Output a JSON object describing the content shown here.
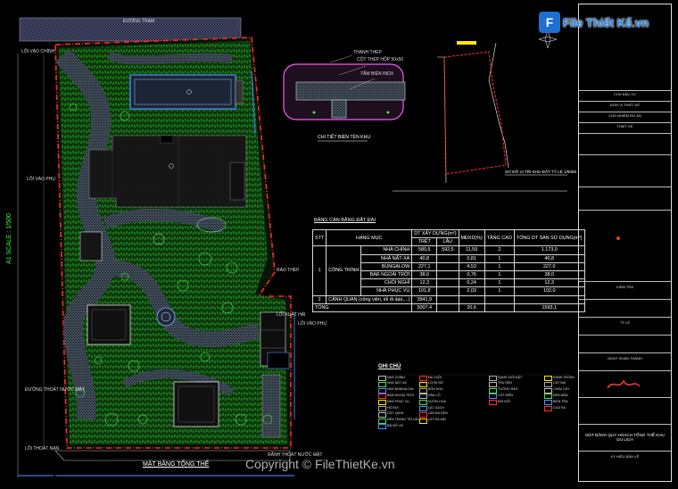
{
  "plan": {
    "top_road": "ĐƯỜNG TRẠM",
    "scale_label": "A1 SCALE : 1/500",
    "plan_title": "MẶT BẰNG TỔNG THỂ",
    "gate_labels": [
      "LỐI VÀO CHÍNH",
      "LỐI VÀO PHỤ",
      "LỐI THOÁT NẠN",
      "LỐI VÀO PHỤ"
    ],
    "side_labels": [
      "RÀO THÉP",
      "LỐI XUẤT HẢI",
      "ĐƯỜNG THOÁT NƯỚC MẶT",
      "RÃNH THOÁT NƯỚC MẶT"
    ],
    "colors": {
      "boundary": "#ff2a2a",
      "vegetation": "#2db52d",
      "water": "#aeb6c8",
      "building": "#1a1a1a",
      "road": "#3a3a3a"
    }
  },
  "details": {
    "section_title": "CHI TIẾT BIỂN TÊN KHU",
    "section_callouts": [
      "THANH THÉP",
      "CỘT THÉP HỘP 50x50",
      "TẤM BIỂN INOX"
    ],
    "location_title": "SƠ ĐỒ VỊ TRÍ KHU ĐẤT TỶ LỆ 1/5000"
  },
  "table": {
    "title": "BẢNG CÂN BẰNG ĐẤT ĐAI",
    "headers": [
      "STT",
      "HẠNG MỤC",
      "DT XÂY DỰNG(m²)",
      "MĐXD(%)",
      "TẦNG CAO",
      "TỔNG DT SÀN SỬ DỤNG(m²)"
    ],
    "subheaders": [
      "TRỆT",
      "LẦU"
    ],
    "group_label": "CÔNG TRÌNH",
    "rows": [
      {
        "stt": "1",
        "name": "NHÀ CHÍNH",
        "tret": "580,5",
        "lau": "592,5",
        "md": "11,59",
        "tang": "2",
        "san": "1.173,0"
      },
      {
        "stt": "",
        "name": "NHÀ NẤT-XA",
        "tret": "40,8",
        "lau": "",
        "md": "0,81",
        "tang": "1",
        "san": "40,8"
      },
      {
        "stt": "",
        "name": "BUNGALOW",
        "tret": "227,1",
        "lau": "",
        "md": "4,53",
        "tang": "1",
        "san": "227,0"
      },
      {
        "stt": "",
        "name": "BAR NGOÀI TRỜI",
        "tret": "38,0",
        "lau": "",
        "md": "0,76",
        "tang": "1",
        "san": "38,0"
      },
      {
        "stt": "",
        "name": "CHÒI NGHỈ",
        "tret": "12,3",
        "lau": "",
        "md": "0,24",
        "tang": "1",
        "san": "12,3"
      },
      {
        "stt": "",
        "name": "NHÀ PHỤC VỤ",
        "tret": "101,8",
        "lau": "",
        "md": "2,03",
        "tang": "1",
        "san": "102,0"
      },
      {
        "stt": "2",
        "name": "CẢNH QUAN (công viên, lối đi dạo,...)",
        "tret": "3941,9",
        "lau": "",
        "md": "",
        "tang": "",
        "san": ""
      }
    ],
    "total": {
      "name": "TỔNG",
      "tret": "5007,4",
      "md": "20,6",
      "san": "1593,1"
    }
  },
  "legend": {
    "title": "GHI CHÚ",
    "items": [
      "NHÀ CHÍNH",
      "NHÀ NẤT-XA",
      "NHÀ BUNGALOW",
      "BAR NGOÀI TRỜI",
      "NHÀ PHỤC VỤ",
      "HỒ BƠI",
      "CÂY XANH",
      "ĐÈN TRANG TRÍ CÂY",
      "BÃI ĐỖ XE",
      "ĐÁ CUỘI",
      "LỐI ĐI BỘ",
      "BỒN HOA",
      "SÂN CỎ",
      "VƯỜN HOA",
      "LÁT GẠCH",
      "LAN ĐÁ ĐẸN",
      "LÁT ĐÁ MÀI",
      "RANH GIỚI ĐẤT",
      "TRỤ ĐÈN",
      "TƯỜNG RÀO",
      "CỘT ĐIỆN",
      "NỐI ĐẤT",
      "RANH TRỒNG",
      "CÂY BỤI",
      "CHẬU CÂY",
      "ĐÈN NẤM",
      "BIỂN TÊN",
      "CỬA RA"
    ]
  },
  "titleblock": {
    "drawing_name": "MẶT BẰNG QUY HOẠCH TỔNG THỂ KHU DU LỊCH",
    "fields": [
      "CHỦ ĐẦU TƯ",
      "ĐƠN VỊ THIẾT KẾ",
      "CHỦ NHIỆM ĐỒ ÁN",
      "THIẾT KẾ",
      "KIỂM TRA",
      "TỶ LỆ",
      "NGÀY HOÀN THÀNH",
      "KÝ HIỆU BẢN VẼ"
    ]
  },
  "watermark": {
    "logo_text": "File Thiết Kế.vn",
    "copyright": "Copyright © FileThietKe.vn"
  }
}
